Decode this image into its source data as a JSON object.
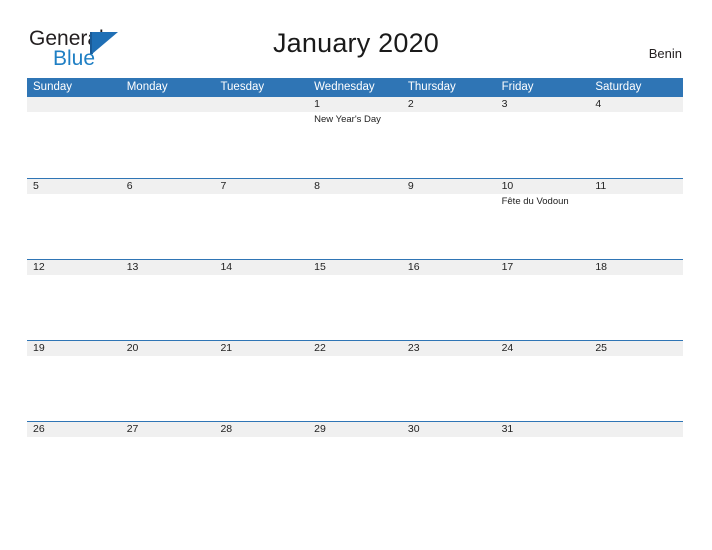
{
  "brand": {
    "name_part1": "General",
    "name_part2": "Blue",
    "color_dark": "#231f20",
    "color_blue": "#1f7fc4",
    "triangle_icon": "triangle-flag-icon"
  },
  "header": {
    "title": "January 2020",
    "country": "Benin",
    "accent_color": "#2f75b5",
    "band_color": "#f0f0f0"
  },
  "weekdays": [
    "Sunday",
    "Monday",
    "Tuesday",
    "Wednesday",
    "Thursday",
    "Friday",
    "Saturday"
  ],
  "weeks": [
    {
      "days": [
        {
          "date": "",
          "event": ""
        },
        {
          "date": "",
          "event": ""
        },
        {
          "date": "",
          "event": ""
        },
        {
          "date": "1",
          "event": "New Year's Day"
        },
        {
          "date": "2",
          "event": ""
        },
        {
          "date": "3",
          "event": ""
        },
        {
          "date": "4",
          "event": ""
        }
      ]
    },
    {
      "days": [
        {
          "date": "5",
          "event": ""
        },
        {
          "date": "6",
          "event": ""
        },
        {
          "date": "7",
          "event": ""
        },
        {
          "date": "8",
          "event": ""
        },
        {
          "date": "9",
          "event": ""
        },
        {
          "date": "10",
          "event": "Fête du Vodoun"
        },
        {
          "date": "11",
          "event": ""
        }
      ]
    },
    {
      "days": [
        {
          "date": "12",
          "event": ""
        },
        {
          "date": "13",
          "event": ""
        },
        {
          "date": "14",
          "event": ""
        },
        {
          "date": "15",
          "event": ""
        },
        {
          "date": "16",
          "event": ""
        },
        {
          "date": "17",
          "event": ""
        },
        {
          "date": "18",
          "event": ""
        }
      ]
    },
    {
      "days": [
        {
          "date": "19",
          "event": ""
        },
        {
          "date": "20",
          "event": ""
        },
        {
          "date": "21",
          "event": ""
        },
        {
          "date": "22",
          "event": ""
        },
        {
          "date": "23",
          "event": ""
        },
        {
          "date": "24",
          "event": ""
        },
        {
          "date": "25",
          "event": ""
        }
      ]
    },
    {
      "days": [
        {
          "date": "26",
          "event": ""
        },
        {
          "date": "27",
          "event": ""
        },
        {
          "date": "28",
          "event": ""
        },
        {
          "date": "29",
          "event": ""
        },
        {
          "date": "30",
          "event": ""
        },
        {
          "date": "31",
          "event": ""
        },
        {
          "date": "",
          "event": ""
        }
      ]
    }
  ]
}
